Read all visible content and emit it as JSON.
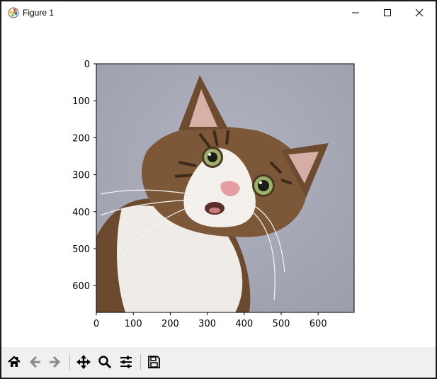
{
  "window": {
    "title": "Figure 1",
    "controls": [
      "minimize",
      "maximize",
      "close"
    ]
  },
  "toolbar": {
    "buttons": [
      {
        "name": "home",
        "icon": "home-icon"
      },
      {
        "name": "back",
        "icon": "arrow-left-icon"
      },
      {
        "name": "forward",
        "icon": "arrow-right-icon"
      },
      {
        "name": "pan",
        "icon": "move-icon"
      },
      {
        "name": "zoom",
        "icon": "magnifier-icon"
      },
      {
        "name": "configure-subplots",
        "icon": "sliders-icon"
      },
      {
        "name": "save",
        "icon": "floppy-disk-icon"
      }
    ]
  },
  "image_axes": {
    "x_ticks": [
      "0",
      "100",
      "200",
      "300",
      "400",
      "500",
      "600"
    ],
    "y_ticks": [
      "0",
      "100",
      "200",
      "300",
      "400",
      "500",
      "600"
    ],
    "image_subject": "cat photo",
    "colors": {
      "background_gray": "#a7a8b6",
      "fur_brown": "#7a5536",
      "fur_white": "#f2efec",
      "eye_green": "#8da15c",
      "nose_pink": "#e6a0a5"
    }
  }
}
